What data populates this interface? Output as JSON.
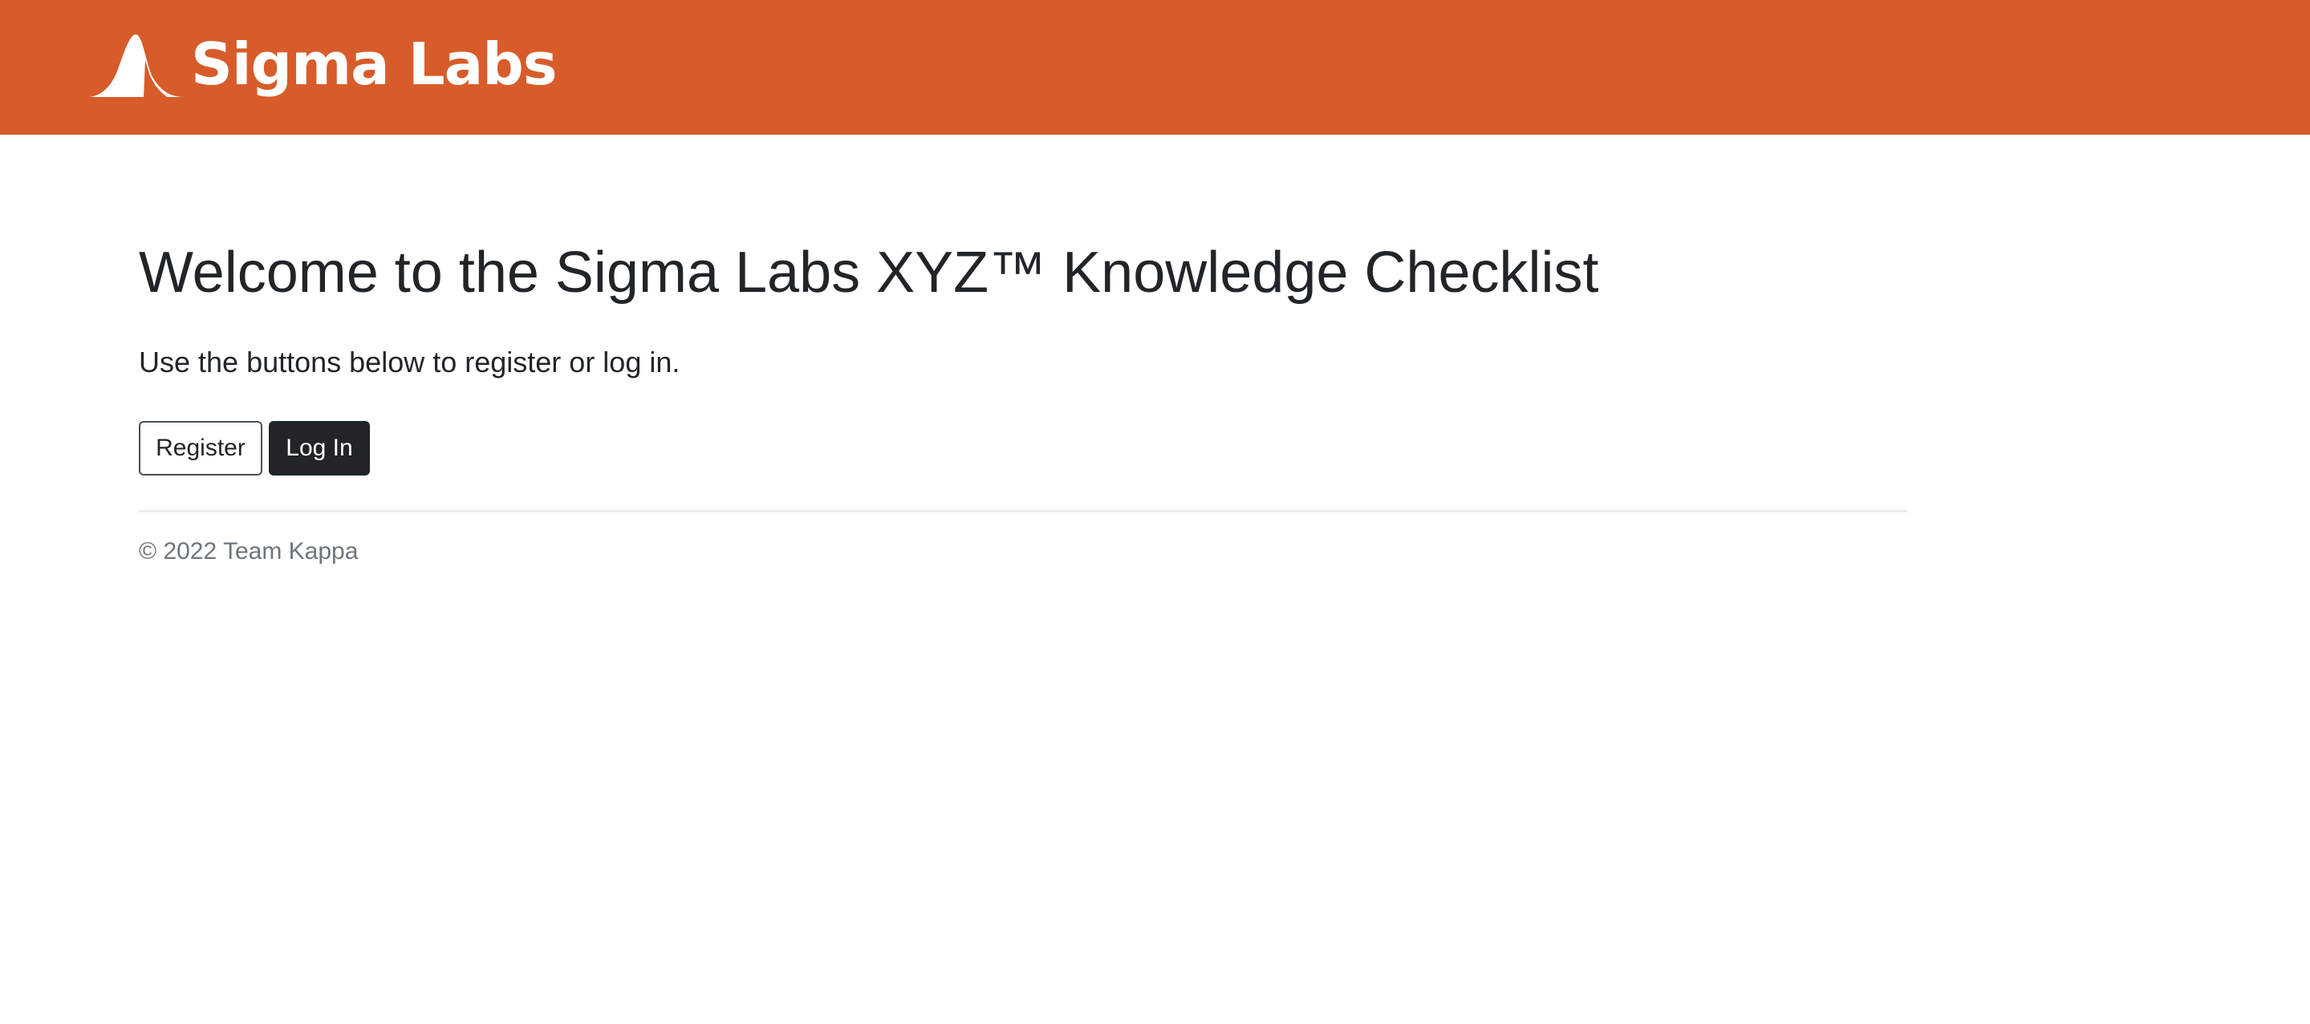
{
  "header": {
    "brand_name": "Sigma Labs",
    "background_color": "#d75c2a",
    "logo_icon": "bell-curve-logo"
  },
  "main": {
    "title": "Welcome to the Sigma Labs XYZ™ Knowledge Checklist",
    "lead": "Use the buttons below to register or log in.",
    "buttons": {
      "register_label": "Register",
      "login_label": "Log In"
    }
  },
  "footer": {
    "copyright": "© 2022 Team Kappa"
  }
}
